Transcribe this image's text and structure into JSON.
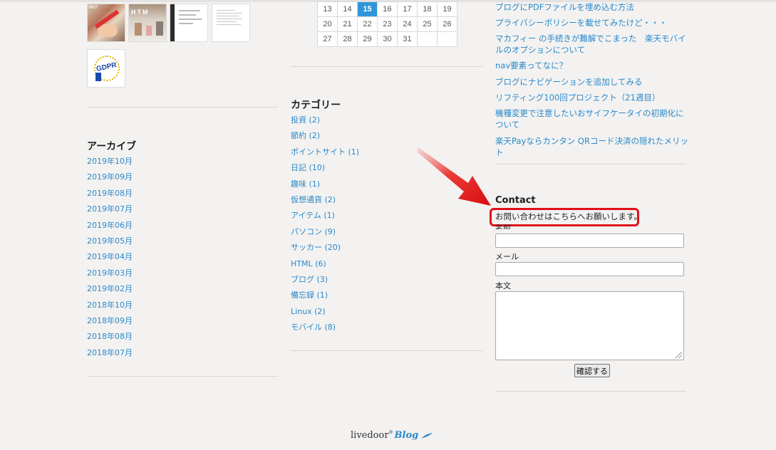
{
  "thumbnails": {
    "t1_tag": "MdT",
    "t2_text": "HTM",
    "t5_text": "GDPR"
  },
  "archive": {
    "title": "アーカイブ",
    "items": [
      "2019年10月",
      "2019年09月",
      "2019年08月",
      "2019年07月",
      "2019年06月",
      "2019年05月",
      "2019年04月",
      "2019年03月",
      "2019年02月",
      "2018年10月",
      "2018年09月",
      "2018年08月",
      "2018年07月"
    ]
  },
  "calendar": {
    "rows": [
      [
        "13",
        "14",
        "15",
        "16",
        "17",
        "18",
        "19"
      ],
      [
        "20",
        "21",
        "22",
        "23",
        "24",
        "25",
        "26"
      ],
      [
        "27",
        "28",
        "29",
        "30",
        "31",
        "",
        ""
      ]
    ],
    "today": "15"
  },
  "categories": {
    "title": "カテゴリー",
    "items": [
      "投資 (2)",
      "節約 (2)",
      "ポイントサイト (1)",
      "日記 (10)",
      "趣味 (1)",
      "仮想通貨 (2)",
      "アイテム (1)",
      "パソコン (9)",
      "サッカー (20)",
      "HTML (6)",
      "ブログ (3)",
      "備忘録 (1)",
      "Linux (2)",
      "モバイル (8)"
    ]
  },
  "recent_posts": {
    "items": [
      "ブログにPDFファイルを埋め込む方法",
      "プライバシーポリシーを載せてみたけど・・・",
      "マカフィー の手続きが難解でこまった　楽天モバイルのオプションについて",
      "nav要素ってなに？",
      "ブログにナビゲーションを追加してみる",
      "リフティング100回プロジェクト（21週目）",
      "機種変更で注意したいおサイフケータイの初期化について",
      "楽天Payならカンタン QRコード決済の隠れたメリット"
    ]
  },
  "contact": {
    "title": "Contact",
    "description": "お問い合わせはこちらへお願いします。",
    "name_label": "名前",
    "email_label": "メール",
    "body_label": "本文",
    "submit_label": "確認する",
    "name_value": "",
    "email_value": "",
    "body_value": ""
  },
  "footer": {
    "brand": "livedoor",
    "brand_sup": "®",
    "blog": "Blog"
  },
  "colors": {
    "link": "#2a88c9",
    "today_bg": "#2f96d9",
    "highlight": "#e0101a",
    "background": "#f3f2f1"
  }
}
